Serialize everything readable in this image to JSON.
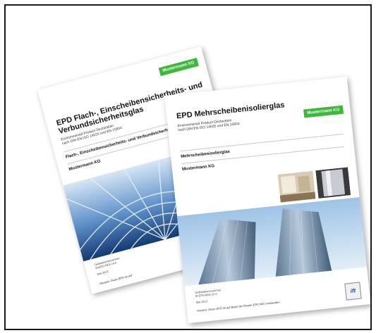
{
  "brochure_back": {
    "brand": "Mustermann KG",
    "title": "EPD Flach-, Einscheibensicherheits- und Verbundsicherheitsglas",
    "subtitle_line1": "Environmental Product Declaration",
    "subtitle_line2": "nach DIN EN ISO 14025 und EN 15804",
    "product": "Flach-, Einscheibensicherheits- und Verbundsicherheitsglas",
    "company": "Mustermann KG",
    "meta_label": "Deklarationsnummer",
    "meta_number": "M-EPD-FEV-14.0",
    "meta_date": "Mai 2012",
    "note": "Hinweis: Diese EPD ist auf"
  },
  "brochure_front": {
    "brand": "Mustermann KG",
    "title": "EPD Mehrscheibenisolierglas",
    "subtitle_line1": "Environmental Product Declaration",
    "subtitle_line2": "nach DIN EN ISO 14025 und EN 15804",
    "product": "Mehrscheibenisolierglas",
    "company": "Mustermann KG",
    "meta_label": "Deklarationsnummer",
    "meta_number": "M-EPD-MIG-12.0",
    "meta_date": "Mai 2012",
    "note": "Hinweis: Diese EPD ist auf Basis der Muster-EPD MIG entstanden.",
    "logo": "ift"
  }
}
